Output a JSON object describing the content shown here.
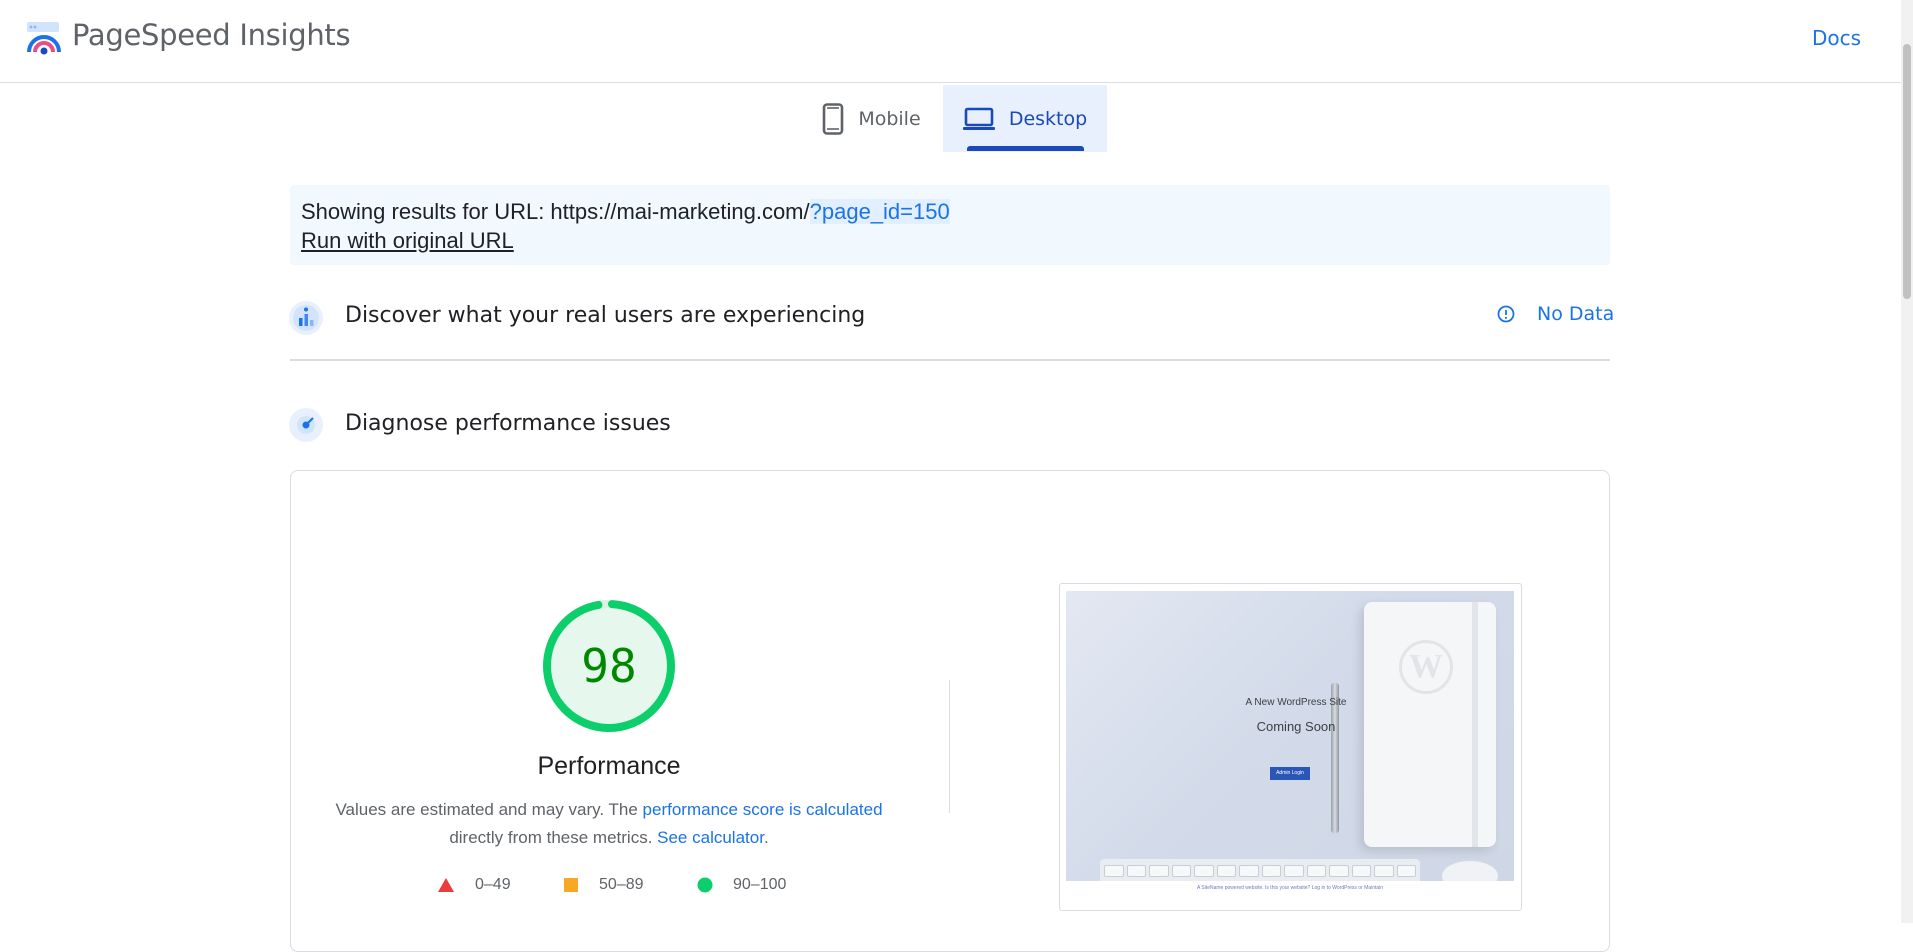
{
  "header": {
    "app_title": "PageSpeed Insights",
    "docs_label": "Docs"
  },
  "tabs": [
    {
      "label": "Mobile",
      "icon": "smartphone-icon",
      "selected": false
    },
    {
      "label": "Desktop",
      "icon": "laptop-icon",
      "selected": true
    }
  ],
  "url_notice": {
    "prefix": "Showing results for URL: https://mai-marketing.com/",
    "highlight": "?page_id=150",
    "run_original_label": "Run with original URL"
  },
  "real_users": {
    "title": "Discover what your real users are experiencing",
    "status_label": "No Data"
  },
  "diagnose": {
    "title": "Diagnose performance issues"
  },
  "performance": {
    "score": "98",
    "score_fraction": 0.98,
    "label": "Performance",
    "desc_part1": "Values are estimated and may vary. The ",
    "desc_link1": "performance score is calculated",
    "desc_part2": " directly from these metrics. ",
    "desc_link2": "See calculator",
    "desc_end": ".",
    "legend": [
      {
        "range": "0–49",
        "shape": "triangle",
        "color": "#eb3c3c"
      },
      {
        "range": "50–89",
        "shape": "square",
        "color": "#f9a825"
      },
      {
        "range": "90–100",
        "shape": "circle",
        "color": "#0cce6b"
      }
    ]
  },
  "screenshot": {
    "site_name": "A New WordPress Site",
    "coming_soon": "Coming Soon",
    "button_label": "Admin Login",
    "footer": "A SiteName powered website. Is this your website? Log in to WordPress or Maintain"
  },
  "colors": {
    "accent": "#1a73e8",
    "tab_selected_bg": "#e8f0fe",
    "tab_selected_text": "#1a4ab8",
    "score_good": "#0cce6b",
    "score_text": "#008800"
  }
}
